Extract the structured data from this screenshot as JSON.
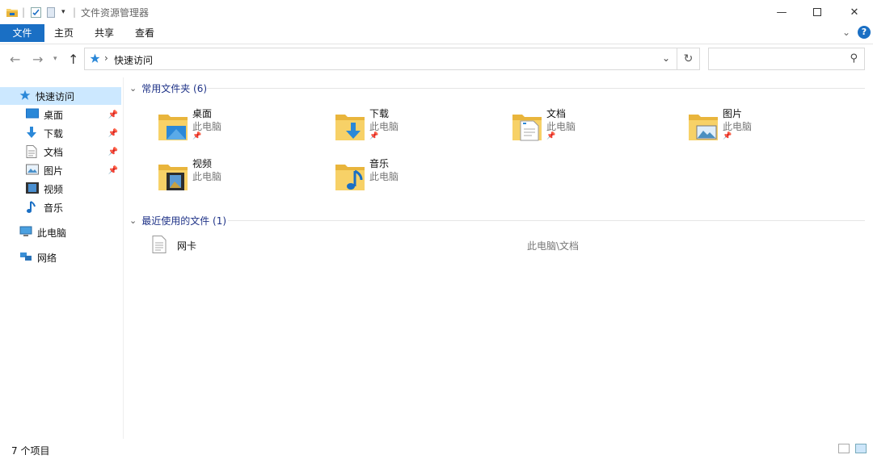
{
  "window": {
    "title": "文件资源管理器"
  },
  "ribbon": {
    "tabs": [
      "文件",
      "主页",
      "共享",
      "查看"
    ],
    "help": "?"
  },
  "address": {
    "crumb": "快速访问"
  },
  "search": {
    "placeholder": ""
  },
  "nav": {
    "quick_access": "快速访问",
    "items": [
      {
        "label": "桌面",
        "icon": "desktop-icon",
        "pinned": true
      },
      {
        "label": "下载",
        "icon": "download-icon",
        "pinned": true
      },
      {
        "label": "文档",
        "icon": "document-icon",
        "pinned": true
      },
      {
        "label": "图片",
        "icon": "picture-icon",
        "pinned": true
      },
      {
        "label": "视频",
        "icon": "video-icon",
        "pinned": false
      },
      {
        "label": "音乐",
        "icon": "music-icon",
        "pinned": false
      }
    ],
    "this_pc": "此电脑",
    "network": "网络"
  },
  "frequent": {
    "heading": "常用文件夹 (6)",
    "folders": [
      {
        "name": "桌面",
        "location": "此电脑",
        "pinned": true,
        "overlay": "desktop"
      },
      {
        "name": "下载",
        "location": "此电脑",
        "pinned": true,
        "overlay": "download"
      },
      {
        "name": "文档",
        "location": "此电脑",
        "pinned": true,
        "overlay": "document"
      },
      {
        "name": "图片",
        "location": "此电脑",
        "pinned": true,
        "overlay": "picture"
      },
      {
        "name": "视频",
        "location": "此电脑",
        "pinned": false,
        "overlay": "video"
      },
      {
        "name": "音乐",
        "location": "此电脑",
        "pinned": false,
        "overlay": "music"
      }
    ]
  },
  "recent": {
    "heading": "最近使用的文件 (1)",
    "files": [
      {
        "name": "网卡",
        "path": "此电脑\\文档"
      }
    ]
  },
  "status": {
    "text": "7 个项目"
  },
  "colors": {
    "accent": "#1a6fc4",
    "folder": "#f7d167",
    "selected": "#cce8ff",
    "group_heading": "#1e3287"
  }
}
